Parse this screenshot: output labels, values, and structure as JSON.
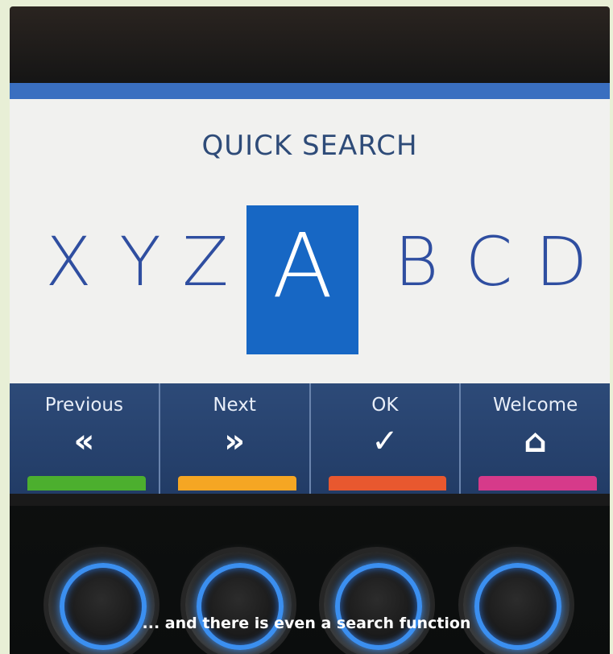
{
  "screen": {
    "title": "QUICK SEARCH",
    "letters": [
      "X",
      "Y",
      "Z",
      "A",
      "B",
      "C",
      "D"
    ],
    "selected_letter": "A",
    "softkeys": [
      {
        "label": "Previous",
        "icon": "double-chevron-left-icon",
        "glyph": "«",
        "color": "#4caf2e"
      },
      {
        "label": "Next",
        "icon": "double-chevron-right-icon",
        "glyph": "»",
        "color": "#f5a623"
      },
      {
        "label": "OK",
        "icon": "checkmark-icon",
        "glyph": "✓",
        "color": "#e8582f"
      },
      {
        "label": "Welcome",
        "icon": "home-icon",
        "glyph": "⌂",
        "color": "#d63a8a"
      }
    ],
    "accent_color": "#1767c4"
  },
  "caption": "... and there is even a search function"
}
